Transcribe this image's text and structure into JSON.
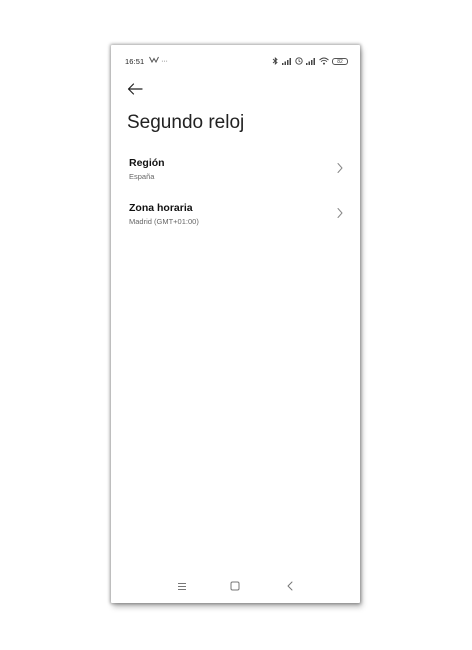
{
  "status_bar": {
    "time": "16:51",
    "left_extra": "…",
    "battery": "82"
  },
  "header": {
    "title": "Segundo reloj"
  },
  "settings": [
    {
      "label": "Región",
      "value": "España"
    },
    {
      "label": "Zona horaria",
      "value": "Madrid (GMT+01:00)"
    }
  ],
  "icons": {
    "back": "arrow-left-icon",
    "chevron": "chevron-right-icon",
    "nav_menu": "menu-icon",
    "nav_home": "square-icon",
    "nav_back": "chevron-left-icon"
  },
  "colors": {
    "text_primary": "#111111",
    "text_secondary": "#666666",
    "icon": "#777777"
  }
}
